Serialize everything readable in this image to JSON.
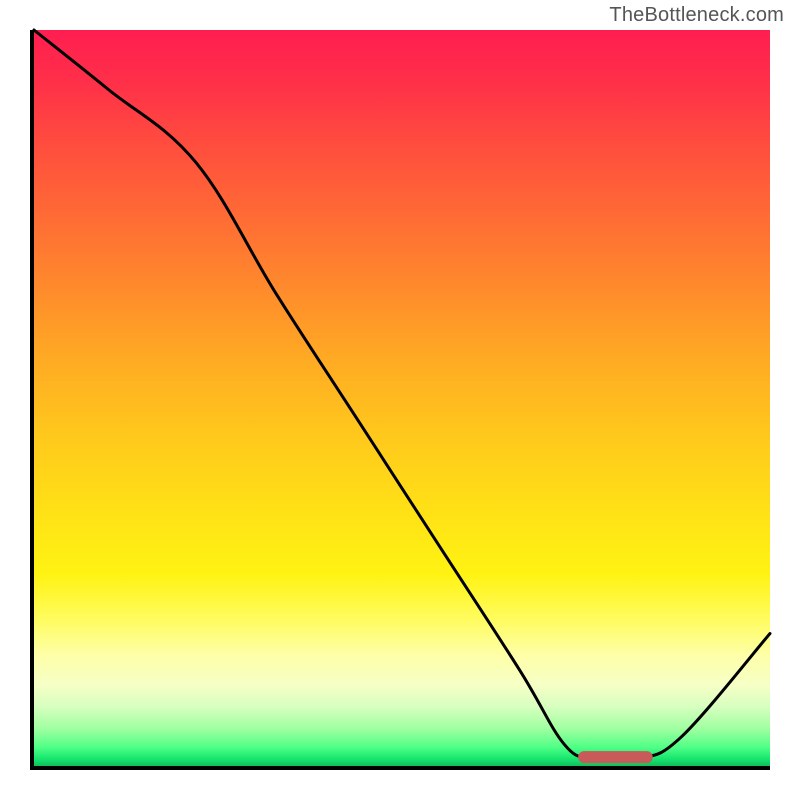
{
  "watermark": "TheBottleneck.com",
  "chart_data": {
    "type": "line",
    "title": "",
    "xlabel": "",
    "ylabel": "",
    "xlim": [
      0,
      100
    ],
    "ylim": [
      0,
      100
    ],
    "x": [
      0,
      10,
      22,
      33,
      44,
      55,
      66,
      72,
      76,
      82,
      88,
      100
    ],
    "values": [
      100,
      92,
      82,
      64,
      47,
      30,
      13,
      3,
      1,
      1,
      4,
      18
    ],
    "marker": {
      "x_start": 74,
      "x_end": 84,
      "y": 1.2
    },
    "gradient_stops": [
      {
        "pos": 0,
        "color": "#ff1e50"
      },
      {
        "pos": 50,
        "color": "#ffc81c"
      },
      {
        "pos": 80,
        "color": "#fffc5e"
      },
      {
        "pos": 95,
        "color": "#9effa0"
      },
      {
        "pos": 100,
        "color": "#0fbf5d"
      }
    ]
  }
}
